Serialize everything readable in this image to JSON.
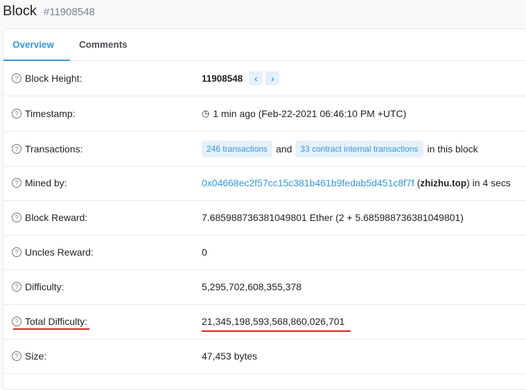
{
  "header": {
    "title": "Block",
    "block_number": "#11908548"
  },
  "tabs": [
    "Overview",
    "Comments"
  ],
  "rows": {
    "block_height": {
      "label": "Block Height:",
      "value": "11908548",
      "prev_icon": "chevron-left-icon",
      "next_icon": "chevron-right-icon"
    },
    "timestamp": {
      "label": "Timestamp:",
      "value": "1 min ago (Feb-22-2021 06:46:10 PM +UTC)",
      "icon": "clock-icon"
    },
    "transactions": {
      "label": "Transactions:",
      "tx_link": "246 transactions",
      "and_text": "and",
      "internal_link": "33 contract internal transactions",
      "suffix": "in this block"
    },
    "mined_by": {
      "label": "Mined by:",
      "address": "0x04668ec2f57cc15c381b461b9fedab5d451c8f7f",
      "open_paren": "(",
      "name": "zhizhu.top",
      "close_text": ") in 4 secs"
    },
    "block_reward": {
      "label": "Block Reward:",
      "value": "7.685988736381049801 Ether (2 + 5.685988736381049801)"
    },
    "uncles_reward": {
      "label": "Uncles Reward:",
      "value": "0"
    },
    "difficulty": {
      "label": "Difficulty:",
      "value": "5,295,702,608,355,378"
    },
    "total_difficulty": {
      "label": "Total Difficulty:",
      "value": "21,345,198,593,568,860,026,701"
    },
    "size": {
      "label": "Size:",
      "value": "47,453 bytes"
    }
  },
  "colors": {
    "link": "#3498db",
    "annotation": "#e41a1c"
  }
}
